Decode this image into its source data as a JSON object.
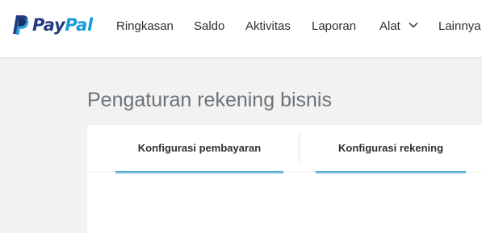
{
  "brand": {
    "logo_pay": "Pay",
    "logo_pal": "Pal",
    "color_dark": "#253b80",
    "color_light": "#179bd7"
  },
  "nav": {
    "items": [
      {
        "label": "Ringkasan"
      },
      {
        "label": "Saldo"
      },
      {
        "label": "Aktivitas"
      },
      {
        "label": "Laporan"
      },
      {
        "label": "Alat",
        "icon": "chevron-down-icon"
      },
      {
        "label": "Lainnya"
      }
    ]
  },
  "page": {
    "title": "Pengaturan rekening bisnis"
  },
  "tabs": [
    {
      "label": "Konfigurasi pembayaran",
      "underline_color": "#1a93cf"
    },
    {
      "label": "Konfigurasi rekening",
      "underline_color": "#1a93cf"
    }
  ]
}
